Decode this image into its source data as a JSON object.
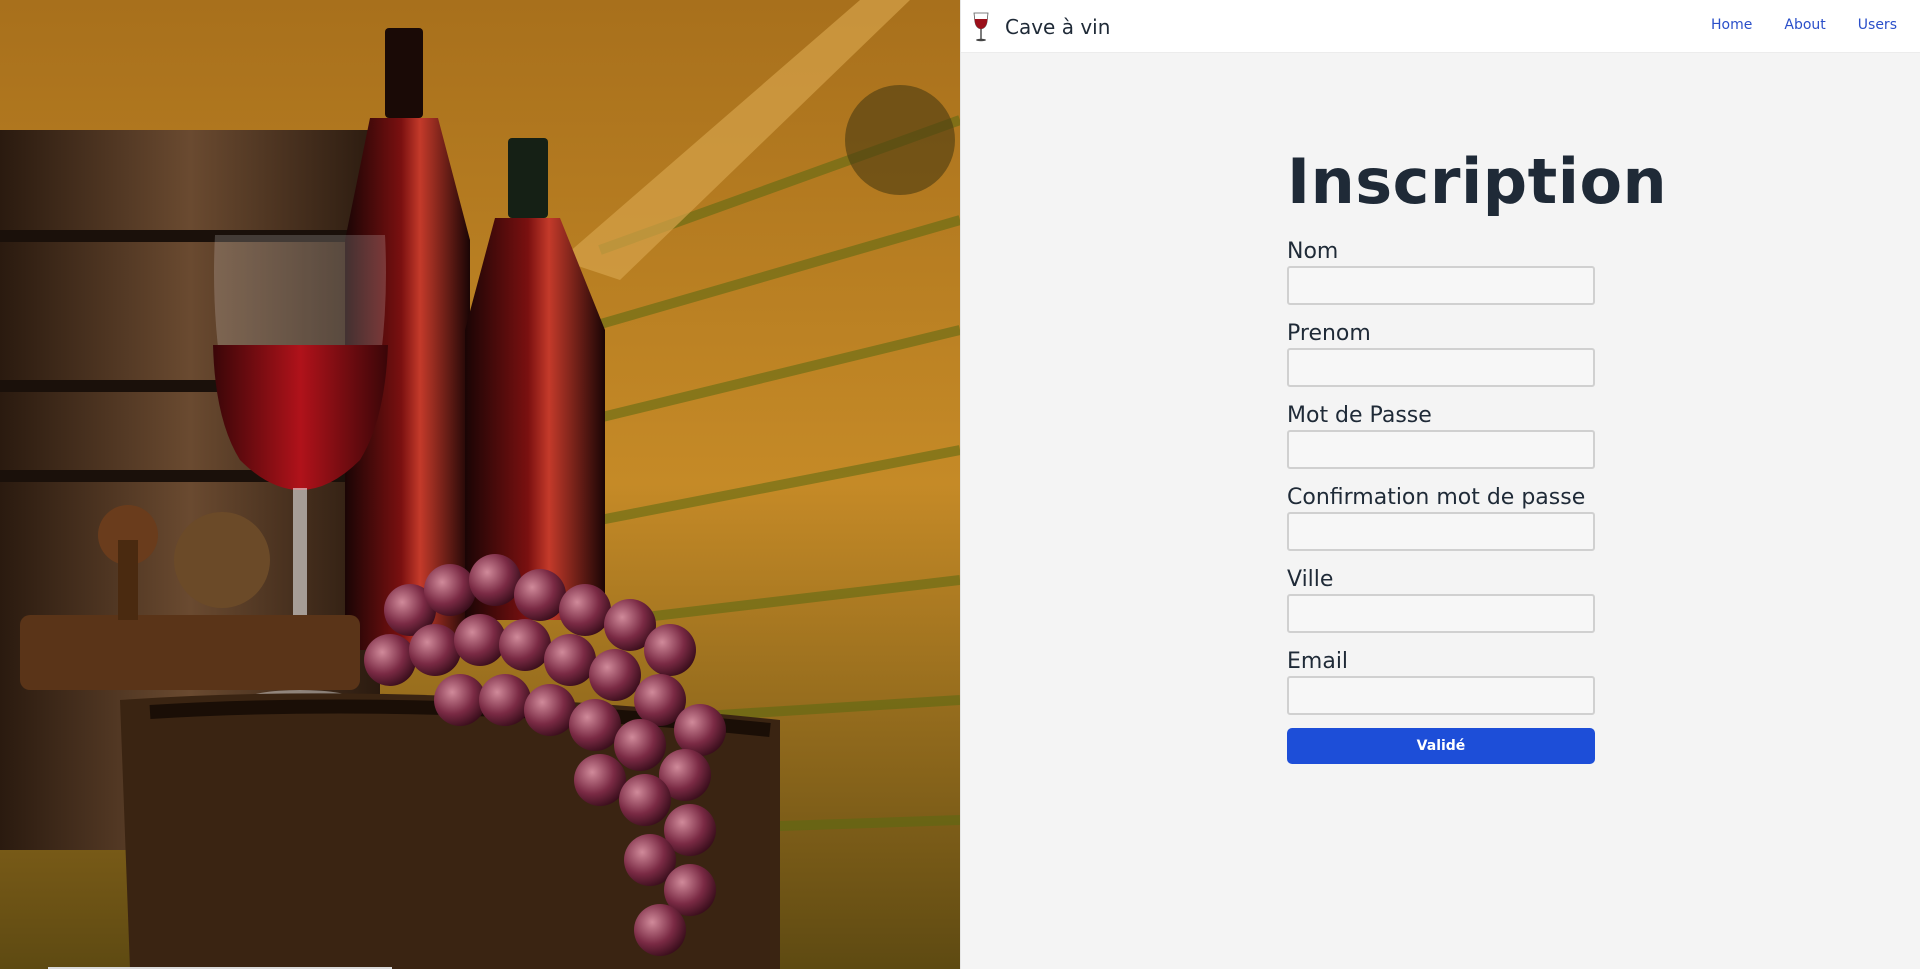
{
  "brand": {
    "name": "Cave à vin",
    "icon": "wine-glass-icon"
  },
  "nav": {
    "items": [
      {
        "label": "Home"
      },
      {
        "label": "About"
      },
      {
        "label": "Users"
      }
    ]
  },
  "form": {
    "title": "Inscription",
    "fields": [
      {
        "label": "Nom",
        "value": "",
        "placeholder": ""
      },
      {
        "label": "Prenom",
        "value": "",
        "placeholder": ""
      },
      {
        "label": "Mot de Passe",
        "value": "",
        "placeholder": ""
      },
      {
        "label": "Confirmation mot de passe",
        "value": "",
        "placeholder": ""
      },
      {
        "label": "Ville",
        "value": "",
        "placeholder": ""
      },
      {
        "label": "Email",
        "value": "",
        "placeholder": ""
      }
    ],
    "submit_label": "Validé"
  },
  "colors": {
    "accent": "#1d4ed8",
    "link": "#2a4fc9",
    "text": "#1f2a37",
    "panel_bg": "#f4f4f4"
  }
}
